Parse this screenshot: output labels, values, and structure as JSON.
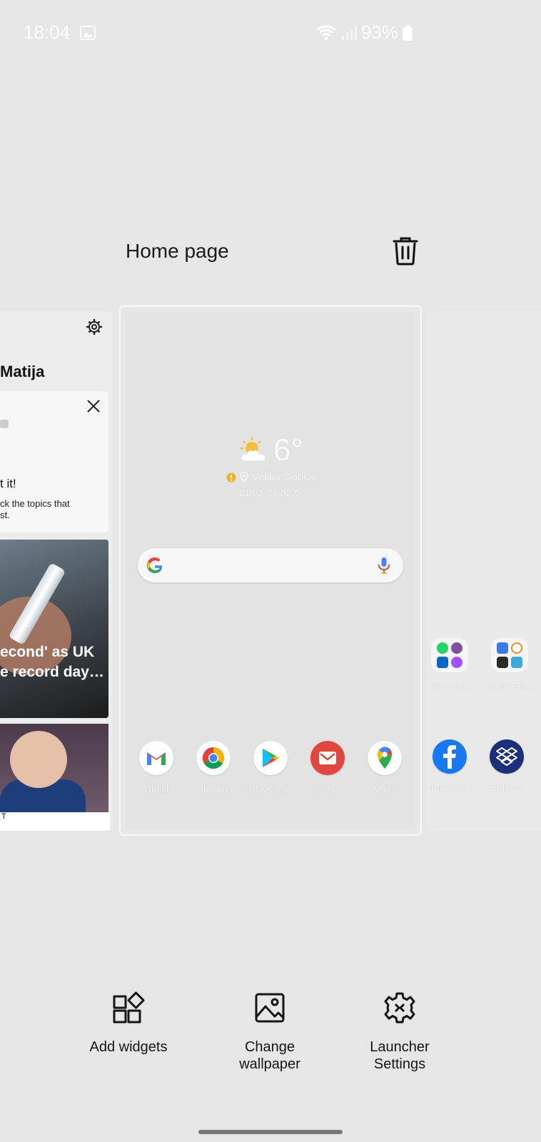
{
  "status_bar": {
    "time": "18:04",
    "battery": "93%",
    "icons": [
      "image-icon",
      "wifi-icon",
      "signal-icon",
      "battery-icon"
    ]
  },
  "page_header": {
    "title": "Home page",
    "delete_icon": "trash-icon"
  },
  "left_panel": {
    "greeting": "Matija",
    "card": {
      "heading": "t it!",
      "line1": "ck the topics that",
      "line2": "st."
    },
    "news": [
      {
        "line1": "econd' as UK",
        "line2": "e record day…"
      },
      {
        "footer": "T"
      }
    ]
  },
  "home_preview": {
    "weather": {
      "temp": "6°",
      "location": "Velika Gorica",
      "updated": "21/03, 18:02"
    },
    "dock": [
      {
        "label": "Gmail",
        "icon": "gmail-icon"
      },
      {
        "label": "Chrome",
        "icon": "chrome-icon"
      },
      {
        "label": "Play Store",
        "icon": "play-store-icon"
      },
      {
        "label": "Email",
        "icon": "email-icon"
      },
      {
        "label": "Maps",
        "icon": "maps-icon"
      }
    ]
  },
  "right_panel": {
    "folders": [
      {
        "label": "Komunik..."
      },
      {
        "label": "Smart Ho..."
      }
    ],
    "dock": [
      {
        "label": "Facebook",
        "icon": "facebook-icon"
      },
      {
        "label": "Dropbox",
        "icon": "dropbox-icon"
      }
    ]
  },
  "toolbar": {
    "add_widgets": "Add widgets",
    "change_wallpaper_1": "Change",
    "change_wallpaper_2": "wallpaper",
    "launcher_settings_1": "Launcher",
    "launcher_settings_2": "Settings"
  }
}
